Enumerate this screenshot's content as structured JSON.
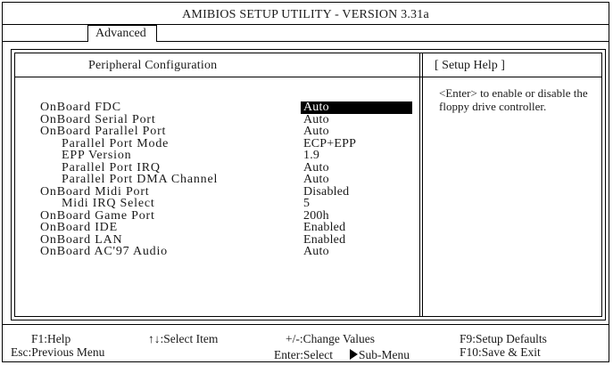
{
  "window": {
    "title": "AMIBIOS SETUP UTILITY - VERSION 3.31a"
  },
  "tabs": [
    {
      "label": "Advanced",
      "active": true
    }
  ],
  "main": {
    "section_title": "Peripheral Configuration",
    "help_title": "[  Setup Help  ]",
    "help_text": "<Enter> to enable or disable the floppy drive controller."
  },
  "settings": [
    {
      "label": "OnBoard FDC",
      "value": "Auto",
      "selected": true,
      "sub": false
    },
    {
      "label": "OnBoard Serial Port",
      "value": "Auto",
      "selected": false,
      "sub": false
    },
    {
      "label": "OnBoard Parallel Port",
      "value": "Auto",
      "selected": false,
      "sub": false
    },
    {
      "label": "Parallel Port Mode",
      "value": "ECP+EPP",
      "selected": false,
      "sub": true
    },
    {
      "label": "EPP Version",
      "value": "1.9",
      "selected": false,
      "sub": true
    },
    {
      "label": "Parallel Port IRQ",
      "value": "Auto",
      "selected": false,
      "sub": true
    },
    {
      "label": "Parallel Port DMA Channel",
      "value": "Auto",
      "selected": false,
      "sub": true
    },
    {
      "label": "OnBoard Midi Port",
      "value": "Disabled",
      "selected": false,
      "sub": false
    },
    {
      "label": "Midi IRQ Select",
      "value": "5",
      "selected": false,
      "sub": true
    },
    {
      "label": "OnBoard Game Port",
      "value": "200h",
      "selected": false,
      "sub": false
    },
    {
      "label": "OnBoard IDE",
      "value": "Enabled",
      "selected": false,
      "sub": false
    },
    {
      "label": "OnBoard LAN",
      "value": "Enabled",
      "selected": false,
      "sub": false
    },
    {
      "label": "OnBoard AC'97 Audio",
      "value": "Auto",
      "selected": false,
      "sub": false
    }
  ],
  "footer": {
    "help": "F1:Help",
    "select_item": "↑↓:Select Item",
    "change_values": "+/-:Change Values",
    "setup_defaults": "F9:Setup Defaults",
    "prev_menu": "Esc:Previous Menu",
    "enter_select": "Enter:Select",
    "sub_menu": "Sub-Menu",
    "save_exit": "F10:Save & Exit"
  }
}
